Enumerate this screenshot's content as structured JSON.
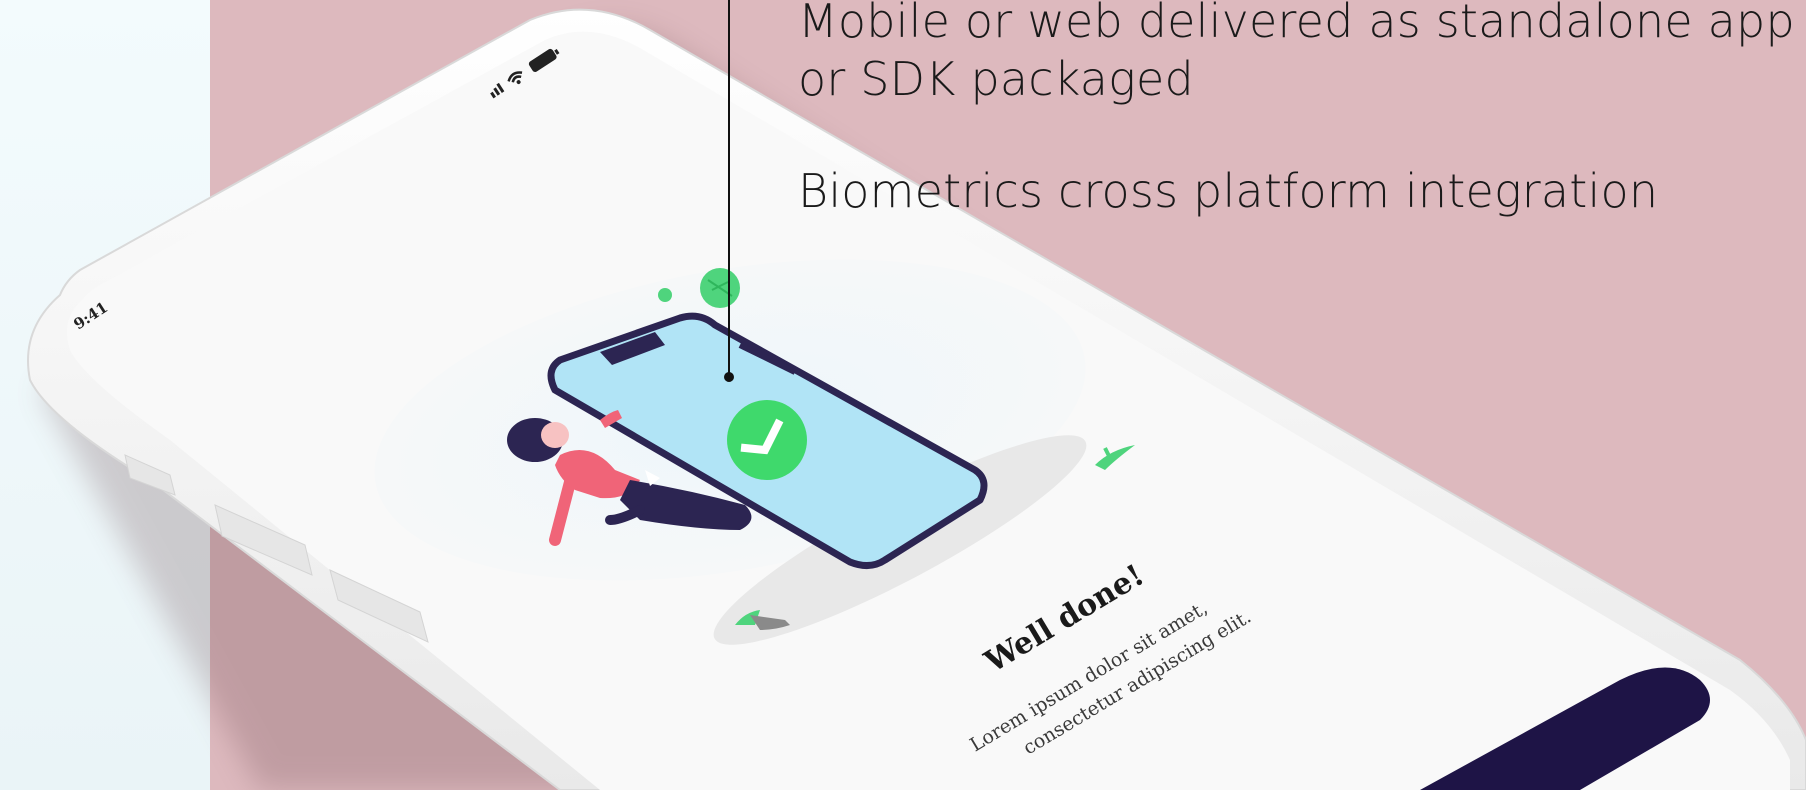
{
  "caption": {
    "line1": "Mobile or web delivered as standalone app",
    "line2": "or SDK packaged",
    "line3": "Biometrics cross platform integration"
  },
  "phone": {
    "status_time": "9:41",
    "headline": "Well done!",
    "body_line1": "Lorem ipsum dolor sit amet,",
    "body_line2": "consectetur adipiscing elit."
  },
  "colors": {
    "background_left": "#eef7fa",
    "background_panel": "#ddb9be",
    "phone_body": "#f7f7f7",
    "illustration_phone_screen": "#b1e4f6",
    "illustration_outline": "#2c2552",
    "check_green": "#3fd96c",
    "person_top": "#f06478",
    "action_button": "#1e1446"
  },
  "icons": [
    "signal-icon",
    "wifi-icon",
    "battery-icon",
    "check-icon",
    "leaf-icon"
  ]
}
